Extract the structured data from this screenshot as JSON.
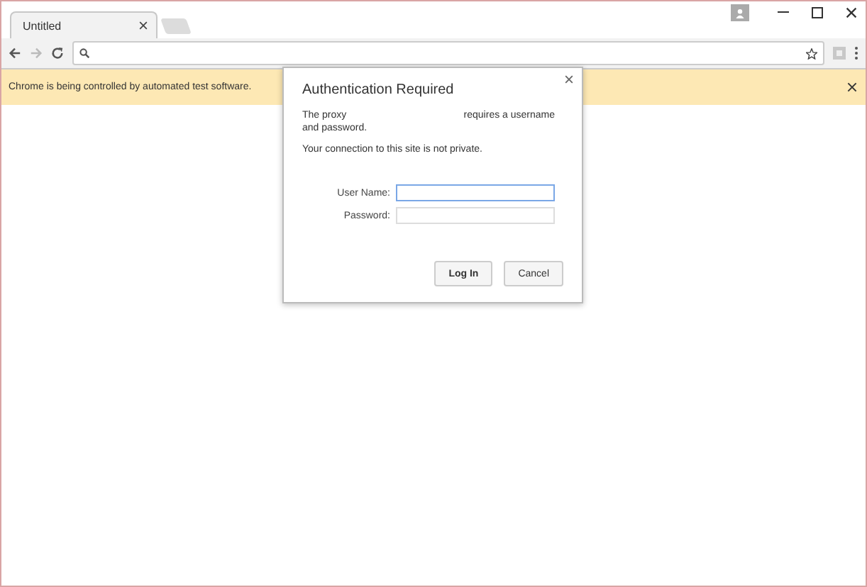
{
  "tab": {
    "title": "Untitled"
  },
  "infobar": {
    "message": "Chrome is being controlled by automated test software."
  },
  "dialog": {
    "title": "Authentication Required",
    "message_start": "The proxy",
    "message_end": "requires a username",
    "message_wrap": "and password.",
    "notice": "Your connection to this site is not private.",
    "fields": [
      {
        "label": "User Name:",
        "focused": true
      },
      {
        "label": "Password:",
        "focused": false
      }
    ],
    "buttons": [
      {
        "label": "Log In",
        "kind": "primary"
      },
      {
        "label": "Cancel",
        "kind": "secondary"
      }
    ]
  }
}
